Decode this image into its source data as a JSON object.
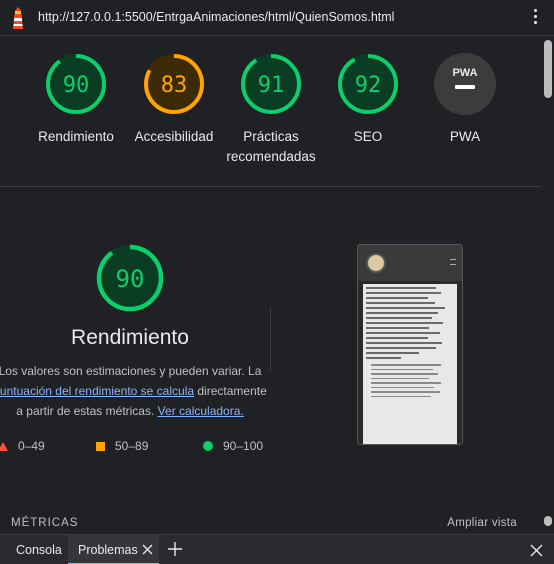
{
  "header": {
    "url": "http://127.0.0.1:5500/EntrgaAnimaciones/html/QuienSomos.html",
    "logo_icon": "lighthouse-icon",
    "menu_icon": "kebab-menu-icon"
  },
  "gauges": [
    {
      "score": "90",
      "label": "Rendimiento",
      "fraction": 0.9,
      "color": "#0cce6b"
    },
    {
      "score": "83",
      "label": "Accesibilidad",
      "fraction": 0.83,
      "color": "#ffa400"
    },
    {
      "score": "91",
      "label": "Prácticas recomendadas",
      "fraction": 0.91,
      "color": "#0cce6b"
    },
    {
      "score": "92",
      "label": "SEO",
      "fraction": 0.92,
      "color": "#0cce6b"
    },
    {
      "score": "PWA",
      "label": "PWA",
      "fraction": 0,
      "color": "#9aa0a6"
    }
  ],
  "performance": {
    "score": "90",
    "fraction": 0.9,
    "title": "Rendimiento",
    "desc_1": "Los valores son estimaciones y pueden variar. La",
    "desc_link_1": "puntuación del rendimiento se calcula",
    "desc_2": "directamente",
    "desc_3": "a partir de estas métricas.",
    "desc_link_2": "Ver calculadora."
  },
  "legend": {
    "fail": "0–49",
    "average": "50–89",
    "pass": "90–100"
  },
  "colors": {
    "pass": "#0cce6b",
    "average": "#ffa400",
    "fail": "#ff4e42",
    "link": "#8ab4f8"
  },
  "metrics": {
    "title": "MÉTRICAS",
    "expand": "Ampliar vista"
  },
  "bottom_tabs": {
    "console": "Consola",
    "problems": "Problemas"
  }
}
